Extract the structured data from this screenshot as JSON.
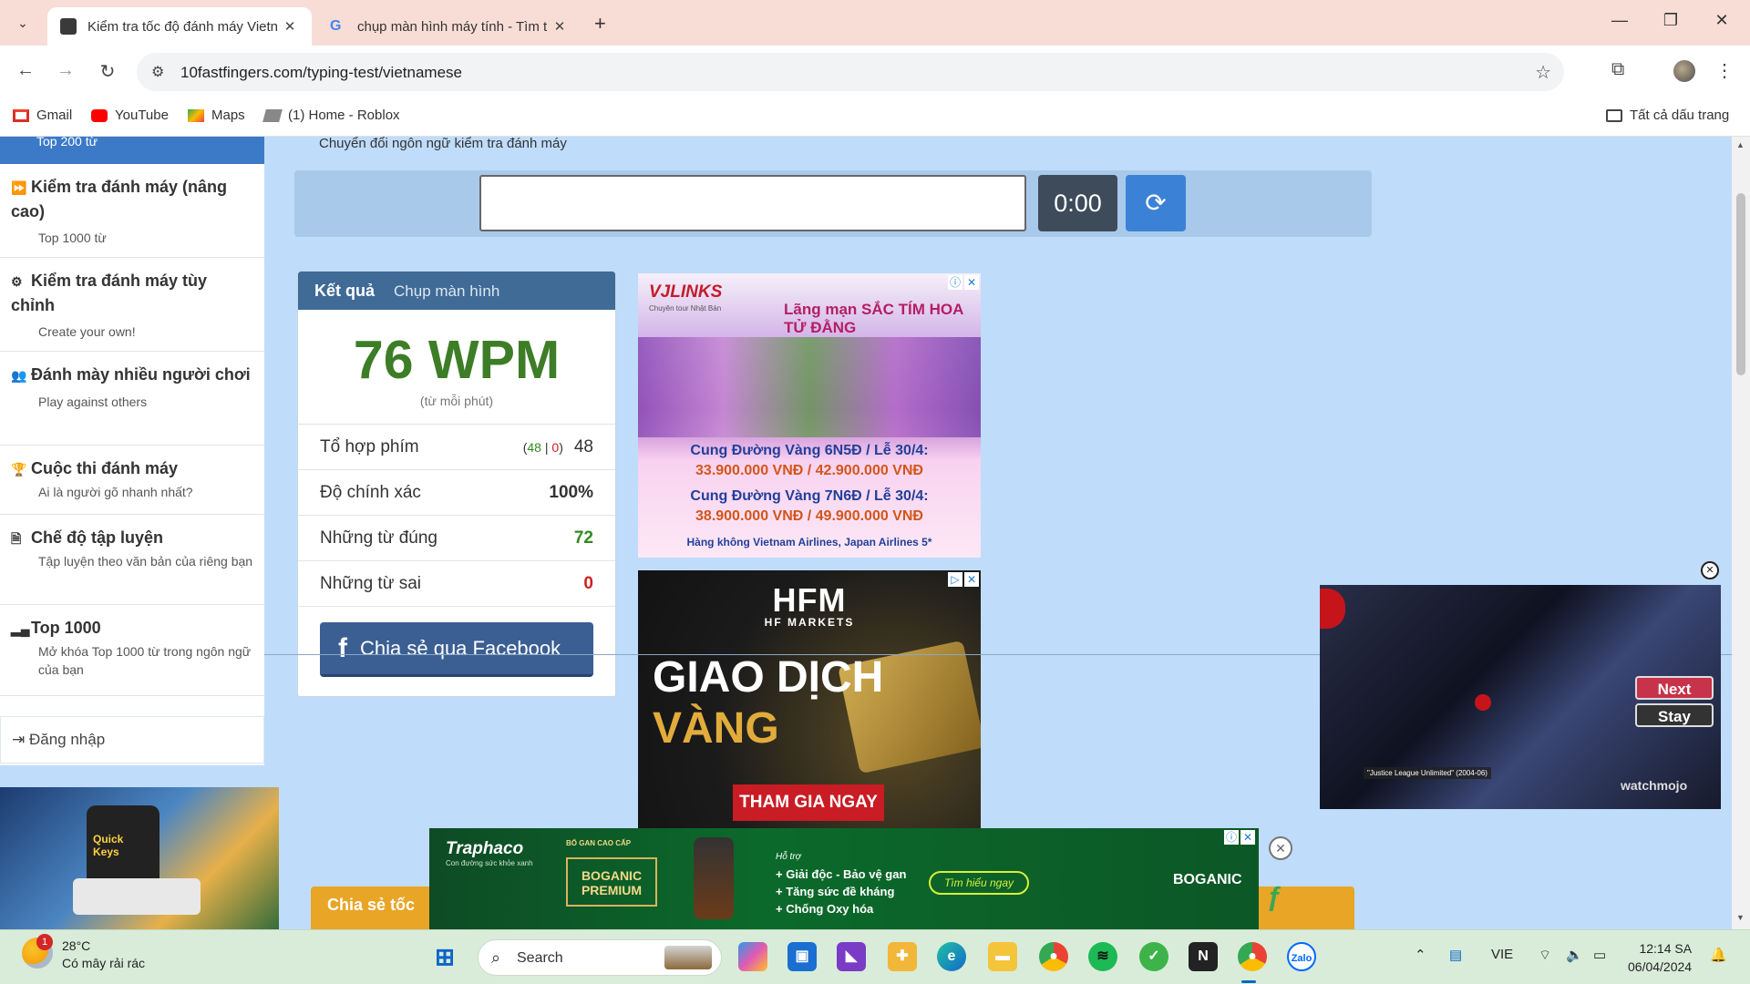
{
  "browser": {
    "tabs": [
      {
        "title": "Kiểm tra tốc độ đánh máy Vietn",
        "active": true
      },
      {
        "title": "chụp màn hình máy tính - Tìm t",
        "active": false
      }
    ],
    "url": "10fastfingers.com/typing-test/vietnamese",
    "bookmarks": [
      "Gmail",
      "YouTube",
      "Maps",
      "(1) Home - Roblox"
    ],
    "all_bookmarks": "Tất cả dấu trang"
  },
  "sidebar": {
    "top_cut": "Top 200 từ",
    "items": [
      {
        "title": "Kiểm tra đánh máy (nâng cao)",
        "sub": "Top 1000 từ",
        "icon": "fast-forward-icon"
      },
      {
        "title": "Kiểm tra đánh máy tùy chỉnh",
        "sub": "Create your own!",
        "icon": "gears-icon"
      },
      {
        "title": "Đánh mày nhiều người chơi",
        "sub": "Play against others",
        "icon": "users-icon"
      },
      {
        "title": "Cuộc thi đánh máy",
        "sub": "Ai là người gõ nhanh nhất?",
        "icon": "trophy-icon"
      },
      {
        "title": "Chế độ tập luyện",
        "sub": "Tập luyện theo văn bản của riêng bạn",
        "icon": "document-icon"
      },
      {
        "title": "Top 1000",
        "sub": "Mở khóa Top 1000 từ trong ngôn ngữ của bạn",
        "icon": "signal-bars-icon"
      }
    ],
    "login": "Đăng nhập"
  },
  "main": {
    "language_switch": "Chuyển đổi ngôn ngữ kiểm tra đánh máy",
    "timer": "0:00",
    "input_value": "",
    "results": {
      "tab_result": "Kết quả",
      "tab_screenshot": "Chụp màn hình",
      "wpm": "76 WPM",
      "wpm_sub": "(từ mỗi phút)",
      "keystrokes_label": "Tổ hợp phím",
      "keystrokes_correct": "48",
      "keystrokes_sep": "|",
      "keystrokes_wrong": "0",
      "keystrokes_total": "48",
      "accuracy_label": "Độ chính xác",
      "accuracy": "100%",
      "correct_words_label": "Những từ đúng",
      "correct_words": "72",
      "wrong_words_label": "Những từ sai",
      "wrong_words": "0",
      "facebook": "Chia sẻ qua Facebook"
    },
    "share_bar": "Chia sẻ tốc"
  },
  "ads": {
    "vjl": {
      "logo": "VJLINKS",
      "tagline": "Chuyên tour Nhật Bản",
      "headline": "Lãng mạn SẮC TÍM HOA TỬ ĐẰNG",
      "line1": "Cung Đường Vàng 6N5Đ / Lễ 30/4:",
      "price1": "33.900.000 VNĐ / 42.900.000 VNĐ",
      "line2": "Cung Đường Vàng 7N6Đ / Lễ 30/4:",
      "price2": "38.900.000 VNĐ / 49.900.000 VNĐ",
      "airlines": "Hàng không Vietnam Airlines, Japan Airlines 5*"
    },
    "hfm": {
      "logo": "HFM",
      "logo_sub": "HF MARKETS",
      "line1": "GIAO DỊCH",
      "line2": "VÀNG",
      "cta": "THAM GIA NGAY"
    },
    "traphaco": {
      "brand": "Traphaco",
      "slogan": "Con đường sức khỏe xanh",
      "premium_label": "BỔ GAN CAO CẤP",
      "product": "BOGANIC PREMIUM",
      "support": "Hỗ trợ",
      "benefit1": "+ Giải độc - Bảo vệ gan",
      "benefit2": "+ Tăng sức đề kháng",
      "benefit3": "+ Chống Oxy hóa",
      "cta": "Tìm hiểu ngay",
      "brand2": "BOGANIC"
    }
  },
  "video": {
    "next": "Next",
    "stay": "Stay",
    "caption": "\"Justice League Unlimited\" (2004-06)",
    "watermark": "watchmojo"
  },
  "taskbar": {
    "temperature": "28°C",
    "weather": "Có mây rải rác",
    "notification_count": "1",
    "search_placeholder": "Search",
    "language": "VIE",
    "time": "12:14 SA",
    "date": "06/04/2024"
  }
}
